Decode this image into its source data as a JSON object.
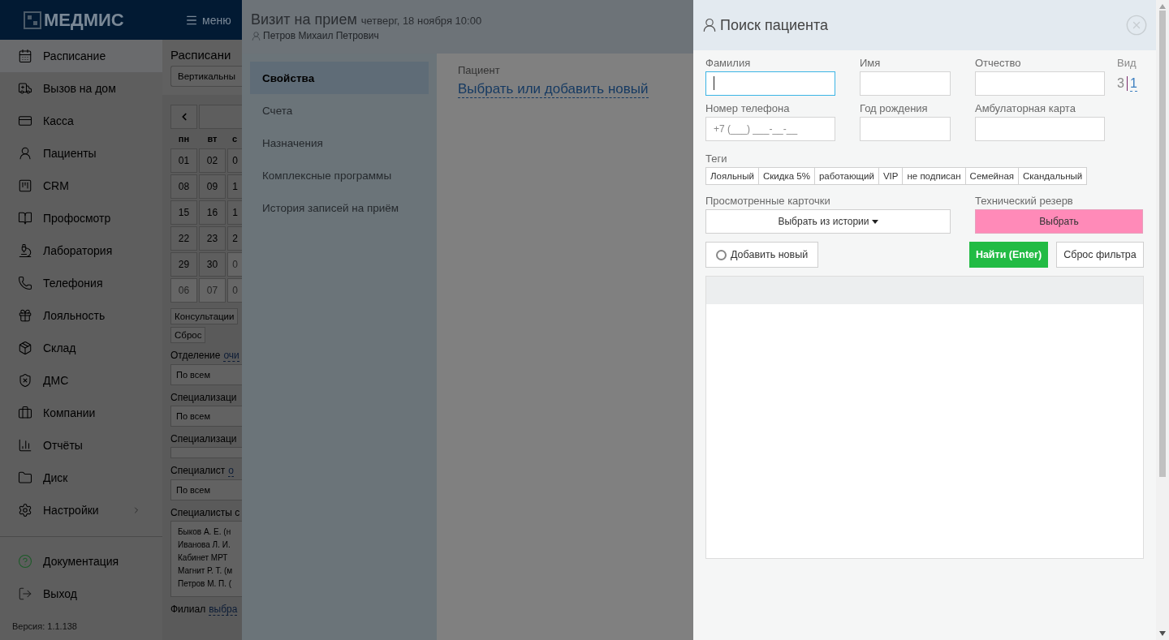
{
  "header": {
    "logo": "МЕДМИС",
    "menu_button": "меню"
  },
  "sidebar": {
    "items": [
      {
        "label": "Расписание",
        "selected": true,
        "expandable": false
      },
      {
        "label": "Вызов на дом",
        "selected": false,
        "expandable": false
      },
      {
        "label": "Касса",
        "selected": false,
        "expandable": false
      },
      {
        "label": "Пациенты",
        "selected": false,
        "expandable": false
      },
      {
        "label": "CRM",
        "selected": false,
        "expandable": false
      },
      {
        "label": "Профосмотр",
        "selected": false,
        "expandable": false
      },
      {
        "label": "Лаборатория",
        "selected": false,
        "expandable": false
      },
      {
        "label": "Телефония",
        "selected": false,
        "expandable": false
      },
      {
        "label": "Лояльность",
        "selected": false,
        "expandable": false
      },
      {
        "label": "Склад",
        "selected": false,
        "expandable": false
      },
      {
        "label": "ДМС",
        "selected": false,
        "expandable": false
      },
      {
        "label": "Компании",
        "selected": false,
        "expandable": false
      },
      {
        "label": "Отчёты",
        "selected": false,
        "expandable": false
      },
      {
        "label": "Диск",
        "selected": false,
        "expandable": false
      },
      {
        "label": "Настройки",
        "selected": false,
        "expandable": true
      }
    ],
    "footer_items": [
      "Документация",
      "Выход"
    ],
    "version": "Версия: 1.1.138"
  },
  "schedule": {
    "title": "Расписани",
    "view_button": "Вертикальны",
    "calendar": {
      "weekdays": [
        "пн",
        "вт",
        "с"
      ],
      "weeks": [
        [
          {
            "day": "01",
            "muted": false
          },
          {
            "day": "02",
            "muted": false
          },
          {
            "day": "0",
            "muted": false
          }
        ],
        [
          {
            "day": "08",
            "muted": false
          },
          {
            "day": "09",
            "muted": false
          },
          {
            "day": "1",
            "muted": false
          }
        ],
        [
          {
            "day": "15",
            "muted": false
          },
          {
            "day": "16",
            "muted": false
          },
          {
            "day": "1",
            "muted": false
          }
        ],
        [
          {
            "day": "22",
            "muted": false
          },
          {
            "day": "23",
            "muted": false
          },
          {
            "day": "2",
            "muted": false
          }
        ],
        [
          {
            "day": "29",
            "muted": false
          },
          {
            "day": "30",
            "muted": false
          },
          {
            "day": "0",
            "muted": true
          }
        ],
        [
          {
            "day": "06",
            "muted": true
          },
          {
            "day": "07",
            "muted": true
          },
          {
            "day": "0",
            "muted": true
          }
        ]
      ]
    },
    "filter_buttons": [
      "Консультации",
      "Сброс"
    ],
    "filters": [
      {
        "label": "Отделение",
        "link": "очи",
        "value": "По всем"
      },
      {
        "label": "Специализаци",
        "value": "По всем"
      },
      {
        "label": "Специализаци"
      },
      {
        "label": "Специалист",
        "link": "о",
        "value": "По всем"
      }
    ],
    "specialists": {
      "label": "Специалисты с",
      "items": [
        "Быков А. Е. (н",
        "Иванова Л. И.",
        "Кабинет МРТ",
        "Магнит Р. Т. (м",
        "Петров М. П. ("
      ]
    },
    "branch": {
      "label": "Филиал",
      "link": "выбра"
    }
  },
  "visit": {
    "title": "Визит на прием",
    "date": "четверг, 18 ноября 10:00",
    "doctor": "Петров Михаил Петрович",
    "tabs": [
      {
        "label": "Свойства",
        "selected": true
      },
      {
        "label": "Счета",
        "selected": false
      },
      {
        "label": "Назначения",
        "selected": false
      },
      {
        "label": "Комплексные программы",
        "selected": false
      },
      {
        "label": "История записей на приём",
        "selected": false
      }
    ],
    "patient_label": "Пациент",
    "patient_link": "Выбрать или добавить новый"
  },
  "patient_search": {
    "title": "Поиск пациента",
    "fields": [
      {
        "label": "Фамилия",
        "focused": true
      },
      {
        "label": "Имя",
        "focused": false
      },
      {
        "label": "Отчество",
        "focused": false
      },
      {
        "label": "Номер телефона",
        "placeholder": "+7 (___) ___-__-__",
        "focused": false
      },
      {
        "label": "Год рождения",
        "focused": false
      },
      {
        "label": "Амбулаторная карта",
        "focused": false
      }
    ],
    "view": {
      "label": "Вид",
      "options": [
        {
          "label": "3",
          "selected": true
        },
        {
          "label": "1",
          "selected": false
        }
      ]
    },
    "tags_label": "Теги",
    "tags": [
      "Лояльный",
      "Скидка 5%",
      "работающий",
      "VIP",
      "не подписан",
      "Семейная",
      "Скандальный"
    ],
    "history": {
      "label": "Просмотренные карточки",
      "button": "Выбрать из истории"
    },
    "reserve": {
      "label": "Технический резерв",
      "button": "Выбрать"
    },
    "add_new": {
      "label": "Добавить новый",
      "checked": false
    },
    "find_button": "Найти (Enter)",
    "reset_button": "Сброс фильтра"
  }
}
